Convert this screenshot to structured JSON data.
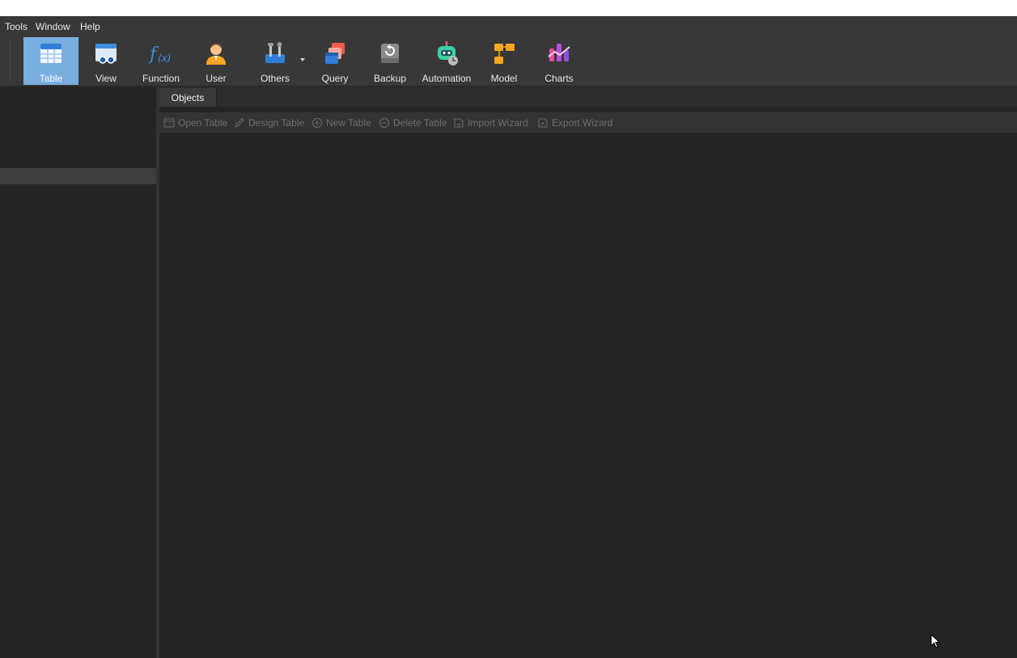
{
  "menu": {
    "items": [
      "Tools",
      "Window",
      "Help"
    ]
  },
  "ribbon": {
    "buttons": [
      {
        "label": "Table",
        "icon": "table-icon",
        "active": true
      },
      {
        "label": "View",
        "icon": "view-icon"
      },
      {
        "label": "Function",
        "icon": "function-icon"
      },
      {
        "label": "User",
        "icon": "user-icon"
      },
      {
        "label": "Others",
        "icon": "others-icon"
      },
      {
        "label": "Query",
        "icon": "query-icon"
      },
      {
        "label": "Backup",
        "icon": "backup-icon"
      },
      {
        "label": "Automation",
        "icon": "automation-icon"
      },
      {
        "label": "Model",
        "icon": "model-icon"
      },
      {
        "label": "Charts",
        "icon": "charts-icon"
      }
    ],
    "accent": "#79aee1"
  },
  "tabs": {
    "objects_label": "Objects"
  },
  "object_toolbar": {
    "items": [
      {
        "label": "Open Table",
        "icon": "open-table-icon"
      },
      {
        "label": "Design Table",
        "icon": "design-table-icon"
      },
      {
        "label": "New Table",
        "icon": "new-table-icon"
      },
      {
        "label": "Delete Table",
        "icon": "delete-table-icon"
      },
      {
        "label": "Import Wizard",
        "icon": "import-wizard-icon"
      },
      {
        "label": "Export Wizard",
        "icon": "export-wizard-icon"
      }
    ]
  }
}
